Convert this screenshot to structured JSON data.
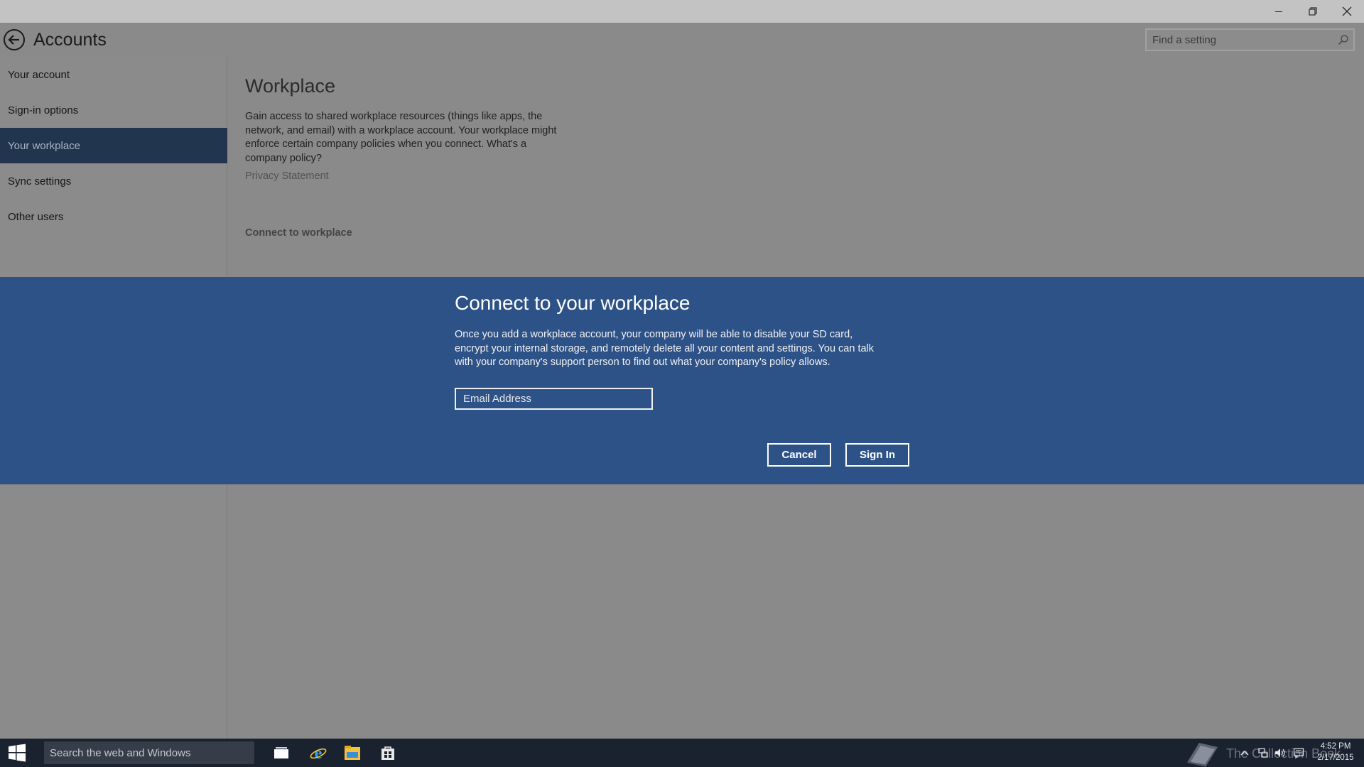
{
  "window": {
    "minimize_icon": "minimize-icon",
    "restore_icon": "restore-icon",
    "close_icon": "close-icon"
  },
  "header": {
    "title": "Accounts",
    "back_icon": "back-arrow-icon",
    "search_placeholder": "Find a setting",
    "search_icon": "search-icon"
  },
  "sidebar": {
    "items": [
      {
        "label": "Your account",
        "active": false
      },
      {
        "label": "Sign-in options",
        "active": false
      },
      {
        "label": "Your workplace",
        "active": true
      },
      {
        "label": "Sync settings",
        "active": false
      },
      {
        "label": "Other users",
        "active": false
      }
    ]
  },
  "main": {
    "title": "Workplace",
    "description": "Gain access to shared workplace resources (things like apps, the network, and email) with a workplace account. Your workplace might enforce certain company policies when you connect. What's a company policy?",
    "privacy_link": "Privacy Statement",
    "connect_link": "Connect to workplace"
  },
  "dialog": {
    "title": "Connect to your workplace",
    "text": "Once you add a workplace account, your company will be able to disable your SD card, encrypt your internal storage, and remotely delete all your content and settings.  You can talk with your company's support person to find out what your company's policy allows.",
    "email_placeholder": "Email Address",
    "cancel_label": "Cancel",
    "signin_label": "Sign In",
    "background_color": "#2d5287"
  },
  "taskbar": {
    "search_text": "Search the web and Windows",
    "icons": [
      "windows-logo-icon",
      "task-view-icon",
      "internet-explorer-icon",
      "file-explorer-icon",
      "store-icon"
    ],
    "watermark_text": "The Collection Book",
    "tray_icons": [
      "chevron-up-icon",
      "network-icon",
      "volume-icon",
      "action-center-icon"
    ],
    "time": "4:52 PM",
    "date": "2/17/2015"
  },
  "colors": {
    "selected_nav": "#22354f",
    "overlay_gray": "#8a8a8a",
    "taskbar": "#1a2230"
  }
}
